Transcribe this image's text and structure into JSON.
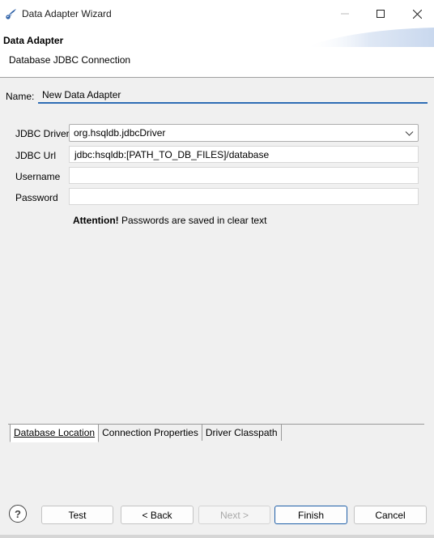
{
  "window": {
    "title": "Data Adapter Wizard"
  },
  "header": {
    "title": "Data Adapter",
    "subtitle": "Database JDBC Connection"
  },
  "name_field": {
    "label": "Name:",
    "value": "New Data Adapter"
  },
  "form": {
    "driver": {
      "label": "JDBC Driver",
      "value": "org.hsqldb.jdbcDriver"
    },
    "url": {
      "label": "JDBC Url",
      "value": "jdbc:hsqldb:[PATH_TO_DB_FILES]/database"
    },
    "username": {
      "label": "Username",
      "value": ""
    },
    "password": {
      "label": "Password",
      "value": ""
    },
    "attention": {
      "strong": "Attention!",
      "text": "Passwords are saved in clear text"
    }
  },
  "tabs": [
    {
      "label": "Database Location",
      "selected": true
    },
    {
      "label": "Connection Properties",
      "selected": false
    },
    {
      "label": "Driver Classpath",
      "selected": false
    }
  ],
  "buttons": {
    "help": "?",
    "test": "Test",
    "back": "< Back",
    "next": "Next >",
    "finish": "Finish",
    "cancel": "Cancel"
  },
  "icons": {
    "app": "app-logo-icon",
    "minimize": "minimize-icon",
    "maximize": "maximize-icon",
    "close": "close-icon",
    "dropdown": "chevron-down-icon",
    "help": "help-icon"
  },
  "colors": {
    "accent": "#2f6db5",
    "title_bar": "#ffffff",
    "background": "#f0f0f0"
  }
}
